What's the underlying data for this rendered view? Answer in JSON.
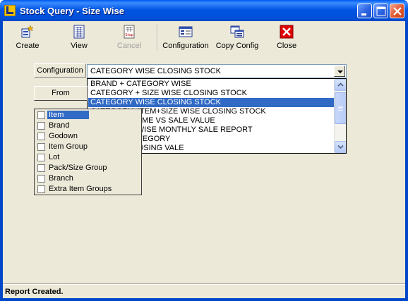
{
  "window": {
    "title": "Stock Query - Size Wise",
    "controls": [
      "minimize-icon",
      "maximize-icon",
      "close-icon"
    ],
    "colors": {
      "titlebar": "#0054e3",
      "client": "#ece9d8",
      "selection": "#316ac5",
      "close": "#e1582f"
    }
  },
  "toolbar": {
    "create": "Create",
    "view": "View",
    "cancel": "Cancel",
    "configuration": "Configuration",
    "copy_config": "Copy Config",
    "close": "Close"
  },
  "config": {
    "label": "Configuration",
    "selected": "CATEGORY WISE CLOSING STOCK"
  },
  "dropdown": {
    "items": [
      "BRAND + CATEGORY WISE",
      "CATEGORY + SIZE WISE CLOSING STOCK",
      "CATEGORY WISE CLOSING STOCK",
      "CATEGORY+ITEM+SIZE WISE CLOSING STOCK",
      "COMPANY NAME VS SALE VALUE",
      "CUSTOMER WISE MONTHLY SALE REPORT",
      "GROUP + CATEGORY",
      "GROUP + CLOSING VALE"
    ],
    "selected_index": 2
  },
  "from_button": "From",
  "group_list": {
    "items": [
      "Item",
      "Brand",
      "Godown",
      "Item Group",
      "Lot",
      "Pack/Size Group",
      "Branch",
      "Extra Item Groups"
    ],
    "highlighted_index": 0
  },
  "status": "Report Created."
}
